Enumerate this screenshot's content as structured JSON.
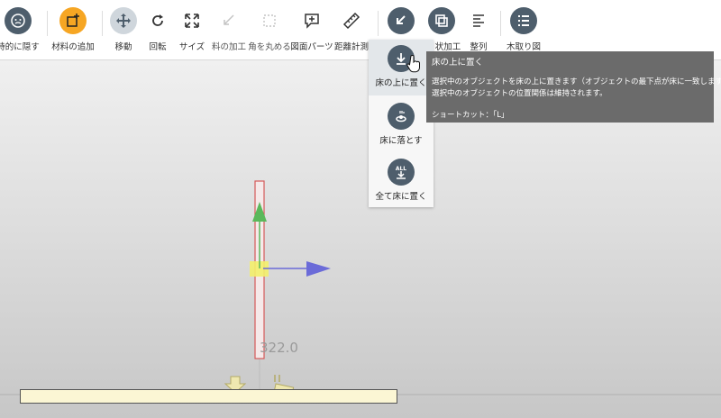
{
  "toolbar": {
    "items": [
      {
        "label": "時的に隠す",
        "icon": "hide-icon"
      },
      {
        "label": "材料の追加",
        "icon": "add-material-icon"
      },
      {
        "label": "移動",
        "icon": "move-icon"
      },
      {
        "label": "回転",
        "icon": "rotate-icon"
      },
      {
        "label": "サイズ",
        "icon": "resize-icon"
      },
      {
        "label": "料の加工",
        "icon": "cut-icon"
      },
      {
        "label": "角を丸める",
        "icon": "round-corner-icon"
      },
      {
        "label": "図面パーツ",
        "icon": "drawing-part-icon"
      },
      {
        "label": "距離計測",
        "icon": "ruler-icon"
      },
      {
        "label": "",
        "icon": "place-on-floor-icon"
      },
      {
        "label": "状加工",
        "icon": "shape-process-icon"
      },
      {
        "label": "整列",
        "icon": "align-icon"
      },
      {
        "label": "木取り図",
        "icon": "cutting-list-icon"
      }
    ]
  },
  "dropdown": {
    "items": [
      {
        "label": "床の上に置く",
        "icon": "place-on-floor-icon"
      },
      {
        "label": "床に落とす",
        "icon": "drop-to-floor-icon"
      },
      {
        "label": "全て床に置く",
        "icon": "all-on-floor-icon"
      }
    ]
  },
  "tooltip": {
    "title": "床の上に置く",
    "line1": "選択中のオブジェクトを床の上に置きます（オブジェクトの最下点が床に一致します）。",
    "line2": "選択中のオブジェクトの位置関係は維持されます。",
    "shortcut": "ショートカット：「L」"
  },
  "viewport": {
    "dimension_value": "322.0"
  },
  "colors": {
    "accent_orange": "#f6a623",
    "icon_dark": "#4e5e6c",
    "tooltip_bg": "#6b6b6b",
    "axis_y": "#5ab85a",
    "axis_x": "#6b6bd8",
    "selection": "#e86f6f",
    "floor": "#fbf6d4"
  }
}
